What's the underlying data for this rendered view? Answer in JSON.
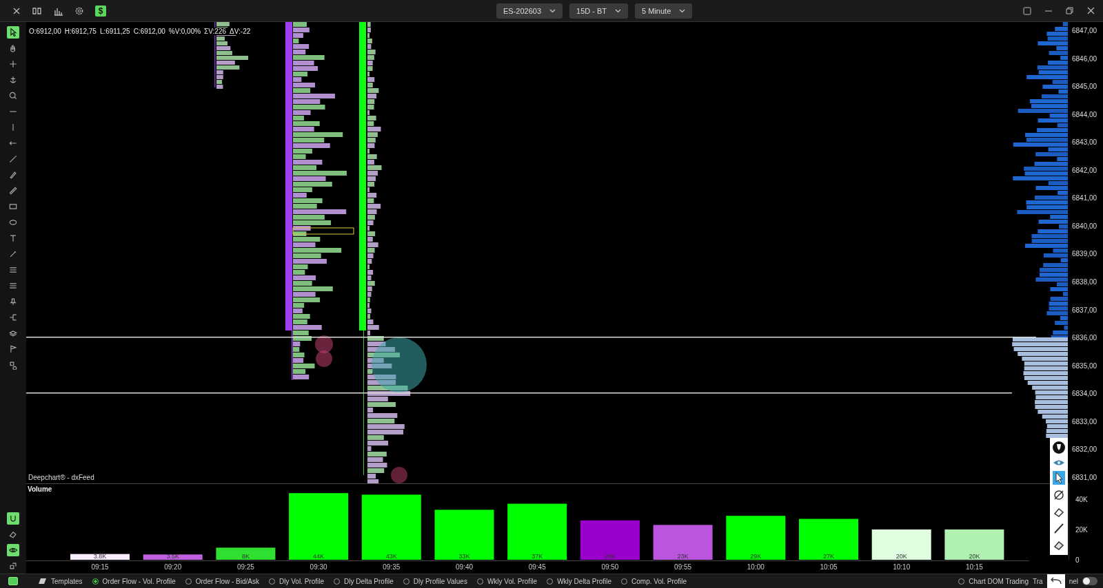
{
  "toolbar": {
    "dollar": "$",
    "dropdowns": [
      {
        "label": "ES-202603"
      },
      {
        "label": "15D - BT"
      },
      {
        "label": "5 Minute"
      }
    ]
  },
  "tools": [
    {
      "kind": "cursor",
      "selected": true
    },
    {
      "kind": "hand",
      "selected": false
    },
    {
      "kind": "crosshair",
      "selected": false
    },
    {
      "kind": "anchor",
      "selected": false
    },
    {
      "kind": "search",
      "selected": false
    },
    {
      "kind": "hline",
      "selected": false
    },
    {
      "kind": "vline",
      "selected": false
    },
    {
      "kind": "arrow",
      "selected": false
    },
    {
      "kind": "line",
      "selected": false
    },
    {
      "kind": "pen",
      "selected": false
    },
    {
      "kind": "ruler",
      "selected": false
    },
    {
      "kind": "rect",
      "selected": false
    },
    {
      "kind": "ellipse",
      "selected": false
    },
    {
      "kind": "text",
      "selected": false
    },
    {
      "kind": "pencil",
      "selected": false
    },
    {
      "kind": "lines",
      "selected": false
    },
    {
      "kind": "lines",
      "selected": false
    },
    {
      "kind": "pin",
      "selected": false
    },
    {
      "kind": "fork",
      "selected": false
    },
    {
      "kind": "layers",
      "selected": false
    },
    {
      "kind": "flag",
      "selected": false
    },
    {
      "kind": "gearsmall",
      "selected": false
    }
  ],
  "bottom_tools": [
    {
      "kind": "magnet",
      "selected": true
    },
    {
      "kind": "eraser",
      "selected": false
    },
    {
      "kind": "eye",
      "selected": true
    },
    {
      "kind": "clone",
      "selected": false
    }
  ],
  "chart": {
    "ohlc": [
      "O:6912,00",
      "H:6912,75",
      "L:6911,25",
      "C:6912,00",
      "%V:0,00%",
      "ΣV:226",
      "ΔV:-22"
    ],
    "source": "Deepchart® - dxFeed",
    "price_labels": [
      "6847,00",
      "6846,00",
      "6845,00",
      "6844,00",
      "6843,00",
      "6842,00",
      "6841,00",
      "6840,00",
      "6839,00",
      "6838,00",
      "6837,00",
      "6836,00",
      "6835,00",
      "6834,00",
      "6833,00",
      "6832,00",
      "6831,00"
    ]
  },
  "volume": {
    "bars": [
      {
        "color": "#f8eeff"
      },
      {
        "color": "#c060e0"
      },
      {
        "color": "#30e030"
      },
      {
        "color": "#00ff00"
      },
      {
        "color": "#00ff00"
      },
      {
        "color": "#00ff00"
      },
      {
        "color": "#00ff00"
      },
      {
        "color": "#9900cc"
      },
      {
        "color": "#bb55dd"
      },
      {
        "color": "#00ff00"
      },
      {
        "color": "#00ff00"
      },
      {
        "color": "#e0ffe0"
      },
      {
        "color": "#b0f0b0"
      }
    ],
    "chart_data": {
      "type": "bar",
      "categories": [
        "09:15",
        "09:20",
        "09:25",
        "09:30",
        "09:35",
        "09:40",
        "09:45",
        "09:50",
        "09:55",
        "10:00",
        "10:05",
        "10:10",
        "10:15"
      ],
      "series": [
        {
          "name": "Volume",
          "values": [
            3800,
            3500,
            8000,
            44000,
            43000,
            33000,
            37000,
            26000,
            23000,
            29000,
            27000,
            20000,
            20000
          ]
        }
      ],
      "value_labels": [
        "3.8K",
        "3.5K",
        "8K",
        "44K",
        "43K",
        "33K",
        "37K",
        "26K",
        "23K",
        "29K",
        "27K",
        "20K",
        "20K"
      ],
      "ylim": [
        0,
        50000
      ],
      "yticks": [
        {
          "value": 0,
          "label": "0"
        },
        {
          "value": 20000,
          "label": "20K"
        },
        {
          "value": 40000,
          "label": "40K"
        }
      ]
    }
  },
  "bottom_bar": {
    "templates": "Templates",
    "tabs": [
      {
        "label": "Order Flow - Vol. Profile",
        "selected": true
      },
      {
        "label": "Order Flow - Bid/Ask",
        "selected": false
      },
      {
        "label": "Dly Vol. Profile",
        "selected": false
      },
      {
        "label": "Dly Delta Profile",
        "selected": false
      },
      {
        "label": "Dly Profile Values",
        "selected": false
      },
      {
        "label": "Wkly Vol. Profile",
        "selected": false
      },
      {
        "label": "Wkly Delta Profile",
        "selected": false
      },
      {
        "label": "Comp. Vol. Profile",
        "selected": false
      }
    ],
    "right_tabs": [
      {
        "label": "Chart DOM Trading",
        "selected": false
      }
    ],
    "panel_label_parts": [
      "Tra",
      "nel"
    ],
    "panel_toggle_on": false
  }
}
